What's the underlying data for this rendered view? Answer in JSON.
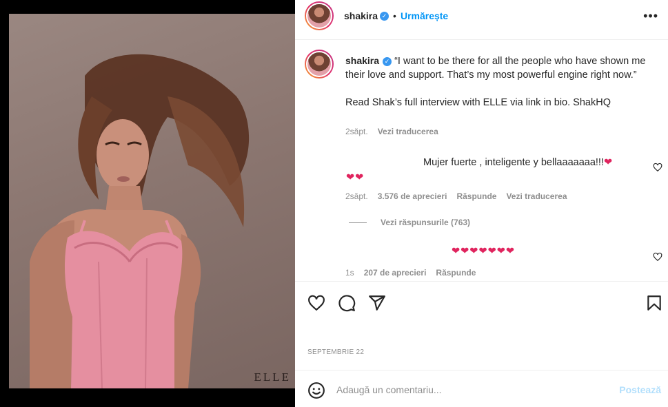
{
  "post": {
    "image_alt": "",
    "image_watermark": "ELLE",
    "colors": {
      "dress": "#e58fa0",
      "background": "#8b7670"
    }
  },
  "header": {
    "username": "shakira",
    "separator": "•",
    "follow_label": "Urmărește",
    "more_label": "•••"
  },
  "caption": {
    "username": "shakira",
    "text": "“I want to be there for all the people who have shown me their love and support. That’s my most powerful engine right now.”",
    "text2": "Read Shak’s full interview with ELLE via link in bio. ShakHQ",
    "time": "2săpt.",
    "translate": "Vezi traducerea"
  },
  "comments": [
    {
      "text": "Mujer fuerte , inteligente y bellaaaaaaa!!!",
      "hearts_inline": "❤",
      "hearts_below": "❤❤",
      "time": "2săpt.",
      "likes": "3.576 de aprecieri",
      "reply": "Răspunde",
      "translate": "Vezi traducerea",
      "view_replies": "Vezi răspunsurile (763)"
    },
    {
      "text": "❤❤❤❤❤❤❤",
      "time": "1s",
      "likes": "207 de aprecieri",
      "reply": "Răspunde"
    }
  ],
  "footer": {
    "date": "SEPTEMBRIE 22",
    "comment_placeholder": "Adaugă un comentariu...",
    "post_label": "Postează"
  },
  "icons": {
    "like": "heart-icon",
    "comment": "comment-icon",
    "share": "send-icon",
    "save": "bookmark-icon",
    "emoji": "emoji-icon"
  }
}
